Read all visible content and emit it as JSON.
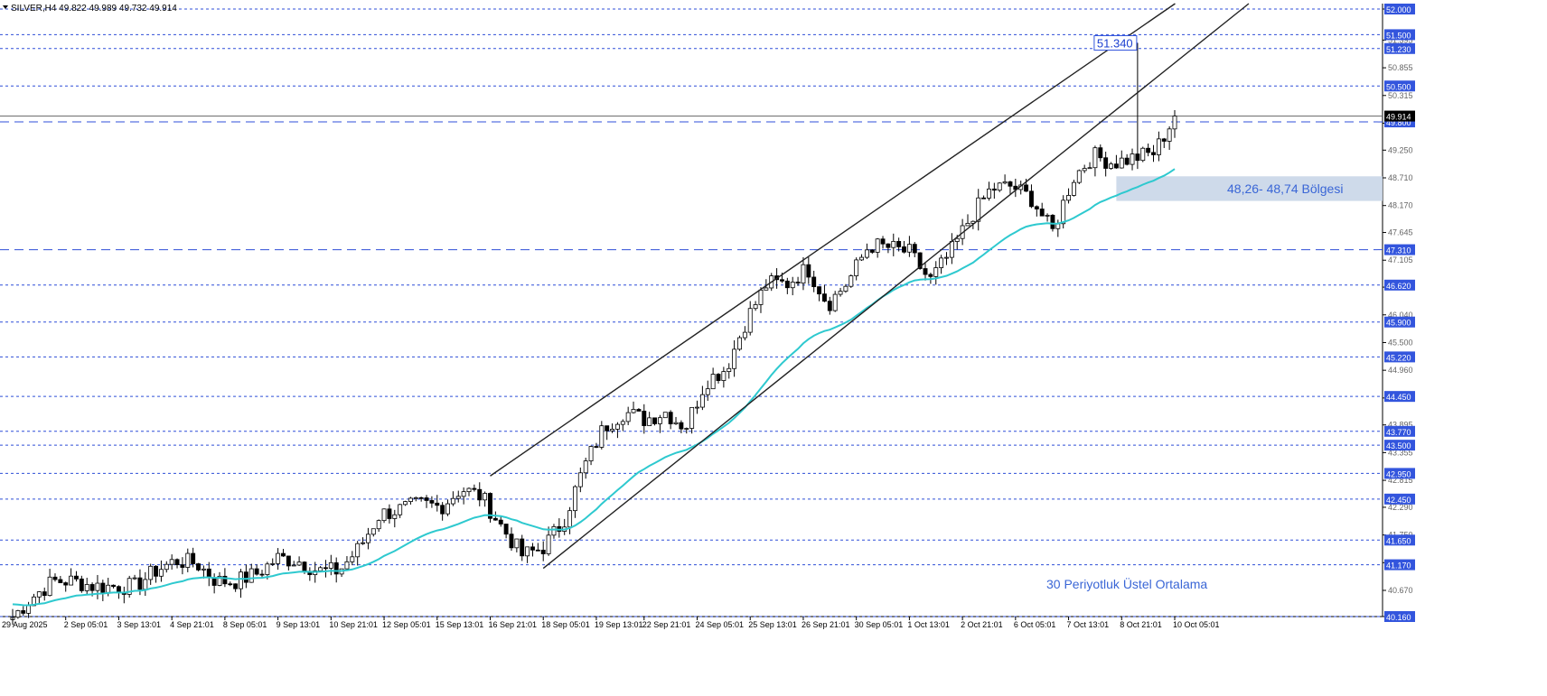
{
  "header": {
    "symbol_info": "SILVER,H4  49.822 49.989 49.732 49.914"
  },
  "colors": {
    "background": "#ffffff",
    "grid": "#2f4fd8",
    "candle_up_fill": "#ffffff",
    "candle_down_fill": "#000000",
    "candle_outline": "#000000",
    "ema": "#2ec9cf",
    "channel": "#222222",
    "zone_fill": "#c9d6e8",
    "label_bg": "#3355dd",
    "label_text": "#ffffff",
    "annotation_text": "#3a66d6"
  },
  "chart_data": {
    "type": "candlestick",
    "ylim": [
      40.0,
      52.2
    ],
    "y_ticks": [
      "52.000",
      "51.395",
      "50.855",
      "50.315",
      "49.775",
      "49.250",
      "48.710",
      "48.170",
      "47.645",
      "47.105",
      "46.580",
      "46.040",
      "45.500",
      "44.960",
      "44.420",
      "43.895",
      "43.355",
      "42.815",
      "42.290",
      "41.750",
      "41.210",
      "40.670",
      "40.160"
    ],
    "level_labels": [
      "52.000",
      "51.500",
      "51.230",
      "50.500",
      "49.800",
      "47.310",
      "46.620",
      "45.900",
      "45.220",
      "44.450",
      "43.770",
      "43.500",
      "42.950",
      "42.450",
      "41.650",
      "41.170",
      "40.160"
    ],
    "current_price_label": "49.914",
    "x_labels": [
      "29 Aug 2025",
      "2 Sep 05:01",
      "3 Sep 13:01",
      "4 Sep 21:01",
      "8 Sep 05:01",
      "9 Sep 13:01",
      "10 Sep 21:01",
      "12 Sep 05:01",
      "15 Sep 13:01",
      "16 Sep 21:01",
      "18 Sep 05:01",
      "19 Sep 13:01",
      "22 Sep 21:01",
      "24 Sep 05:01",
      "25 Sep 13:01",
      "26 Sep 21:01",
      "30 Sep 05:01",
      "1 Oct 13:01",
      "2 Oct 21:01",
      "6 Oct 05:01",
      "7 Oct 13:01",
      "8 Oct 21:01",
      "10 Oct 05:01"
    ],
    "anchors": [
      [
        40.1,
        40.2
      ],
      [
        40.5,
        40.6
      ],
      [
        40.8,
        40.9
      ],
      [
        40.9,
        40.8
      ],
      [
        40.7,
        40.8
      ],
      [
        40.9,
        40.6
      ],
      [
        40.6,
        40.9
      ],
      [
        41.1,
        41.0
      ],
      [
        41.2,
        41.3
      ],
      [
        41.4,
        41.0
      ],
      [
        40.8,
        40.9
      ],
      [
        40.9,
        40.8
      ],
      [
        40.7,
        41.3
      ],
      [
        41.4,
        41.2
      ],
      [
        41.2,
        41.3
      ],
      [
        41.1,
        41.0
      ],
      [
        41.0,
        41.1
      ],
      [
        41.3,
        41.7
      ],
      [
        42.0,
        42.3
      ],
      [
        42.2,
        42.3
      ],
      [
        42.4,
        42.3
      ],
      [
        42.2,
        42.4
      ],
      [
        42.6,
        42.7
      ],
      [
        42.6,
        42.4
      ],
      [
        42.0,
        41.8
      ],
      [
        41.5,
        41.2
      ],
      [
        41.4,
        41.6
      ],
      [
        41.8,
        42.2
      ],
      [
        42.8,
        43.3
      ],
      [
        43.9,
        43.8
      ],
      [
        44.1,
        44.2
      ],
      [
        43.9,
        44.1
      ],
      [
        44.3,
        44.0
      ],
      [
        43.8,
        43.9
      ],
      [
        44.5,
        45.0
      ],
      [
        44.8,
        45.2
      ],
      [
        45.7,
        46.2
      ],
      [
        46.6,
        46.7
      ],
      [
        46.5,
        46.8
      ],
      [
        46.9,
        47.0
      ],
      [
        46.1,
        46.4
      ],
      [
        46.5,
        46.9
      ],
      [
        47.3,
        47.5
      ],
      [
        47.3,
        47.4
      ],
      [
        47.2,
        47.3
      ],
      [
        46.8,
        46.6
      ],
      [
        47.0,
        47.5
      ],
      [
        47.7,
        48.2
      ],
      [
        48.4,
        48.6
      ],
      [
        48.6,
        48.5
      ],
      [
        48.4,
        48.2
      ],
      [
        47.6,
        47.7
      ],
      [
        48.5,
        48.9
      ],
      [
        49.3,
        49.0
      ],
      [
        48.8,
        49.2
      ],
      [
        49.6,
        48.6
      ],
      [
        48.7,
        49.7
      ],
      [
        49.9,
        49.9
      ]
    ],
    "ema_start": 40.4,
    "channel_upper": {
      "start_date": "16 Sep 21:01",
      "start_price": 42.9,
      "end_date": "10 Oct 05:01",
      "end_price": 52.1
    },
    "channel_lower": {
      "start_date": "18 Sep 05:01",
      "start_price": 41.1,
      "end_date": "10 Oct 05:01",
      "end_price": 50.95
    },
    "zone": {
      "low": 48.26,
      "high": 48.74,
      "label": "48,26- 48,74 Bölgesi"
    },
    "high_annotation": {
      "value": 51.34,
      "label": "51.340"
    },
    "ema_annotation": "30 Periyotluk Üstel Ortalama",
    "dashed_level": 49.8,
    "dashed_level_2": 47.31,
    "current_price": 49.914,
    "candle_count": 220,
    "chart_type": "candlestick with 30-period EMA and ascending channel"
  }
}
